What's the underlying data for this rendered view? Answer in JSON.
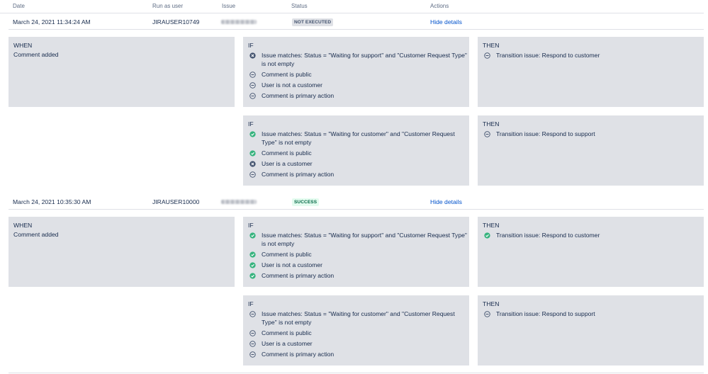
{
  "header": {
    "date": "Date",
    "run_as_user": "Run as user",
    "issue": "Issue",
    "status": "Status",
    "actions": "Actions"
  },
  "logs": [
    {
      "date": "March 24, 2021 11:34:24 AM",
      "user": "JIRAUSER10749",
      "status": "NOT EXECUTED",
      "action": "Hide details",
      "when": {
        "title": "WHEN",
        "text": "Comment added"
      },
      "branches": [
        {
          "if_title": "IF",
          "conditions": [
            {
              "icon": "x-circle-icon",
              "text": "Issue matches: Status = \"Waiting for support\" and \"Customer Request Type\" is not empty"
            },
            {
              "icon": "minus-circle-icon",
              "text": "Comment is public"
            },
            {
              "icon": "minus-circle-icon",
              "text": "User is not a customer"
            },
            {
              "icon": "minus-circle-icon",
              "text": "Comment is primary action"
            }
          ],
          "then_title": "THEN",
          "then": {
            "icon": "minus-circle-icon",
            "text": "Transition issue: Respond to customer"
          }
        },
        {
          "if_title": "IF",
          "conditions": [
            {
              "icon": "check-circle-icon",
              "text": "Issue matches: Status = \"Waiting for customer\" and \"Customer Request Type\" is not empty"
            },
            {
              "icon": "check-circle-icon",
              "text": "Comment is public"
            },
            {
              "icon": "x-circle-icon",
              "text": "User is a customer"
            },
            {
              "icon": "minus-circle-icon",
              "text": "Comment is primary action"
            }
          ],
          "then_title": "THEN",
          "then": {
            "icon": "minus-circle-icon",
            "text": "Transition issue: Respond to support"
          }
        }
      ]
    },
    {
      "date": "March 24, 2021 10:35:30 AM",
      "user": "JIRAUSER10000",
      "status": "SUCCESS",
      "action": "Hide details",
      "when": {
        "title": "WHEN",
        "text": "Comment added"
      },
      "branches": [
        {
          "if_title": "IF",
          "conditions": [
            {
              "icon": "check-circle-icon",
              "text": "Issue matches: Status = \"Waiting for support\" and \"Customer Request Type\" is not empty"
            },
            {
              "icon": "check-circle-icon",
              "text": "Comment is public"
            },
            {
              "icon": "check-circle-icon",
              "text": "User is not a customer"
            },
            {
              "icon": "check-circle-icon",
              "text": "Comment is primary action"
            }
          ],
          "then_title": "THEN",
          "then": {
            "icon": "check-circle-icon",
            "text": "Transition issue: Respond to customer"
          }
        },
        {
          "if_title": "IF",
          "conditions": [
            {
              "icon": "minus-circle-icon",
              "text": "Issue matches: Status = \"Waiting for customer\" and \"Customer Request Type\" is not empty"
            },
            {
              "icon": "minus-circle-icon",
              "text": "Comment is public"
            },
            {
              "icon": "minus-circle-icon",
              "text": "User is a customer"
            },
            {
              "icon": "minus-circle-icon",
              "text": "Comment is primary action"
            }
          ],
          "then_title": "THEN",
          "then": {
            "icon": "minus-circle-icon",
            "text": "Transition issue: Respond to support"
          }
        }
      ]
    }
  ],
  "colors": {
    "success": "#36b37e",
    "failure": "#42526e",
    "skipped": "#42526e",
    "link": "#0052cc",
    "panel": "#dfe1e6"
  }
}
